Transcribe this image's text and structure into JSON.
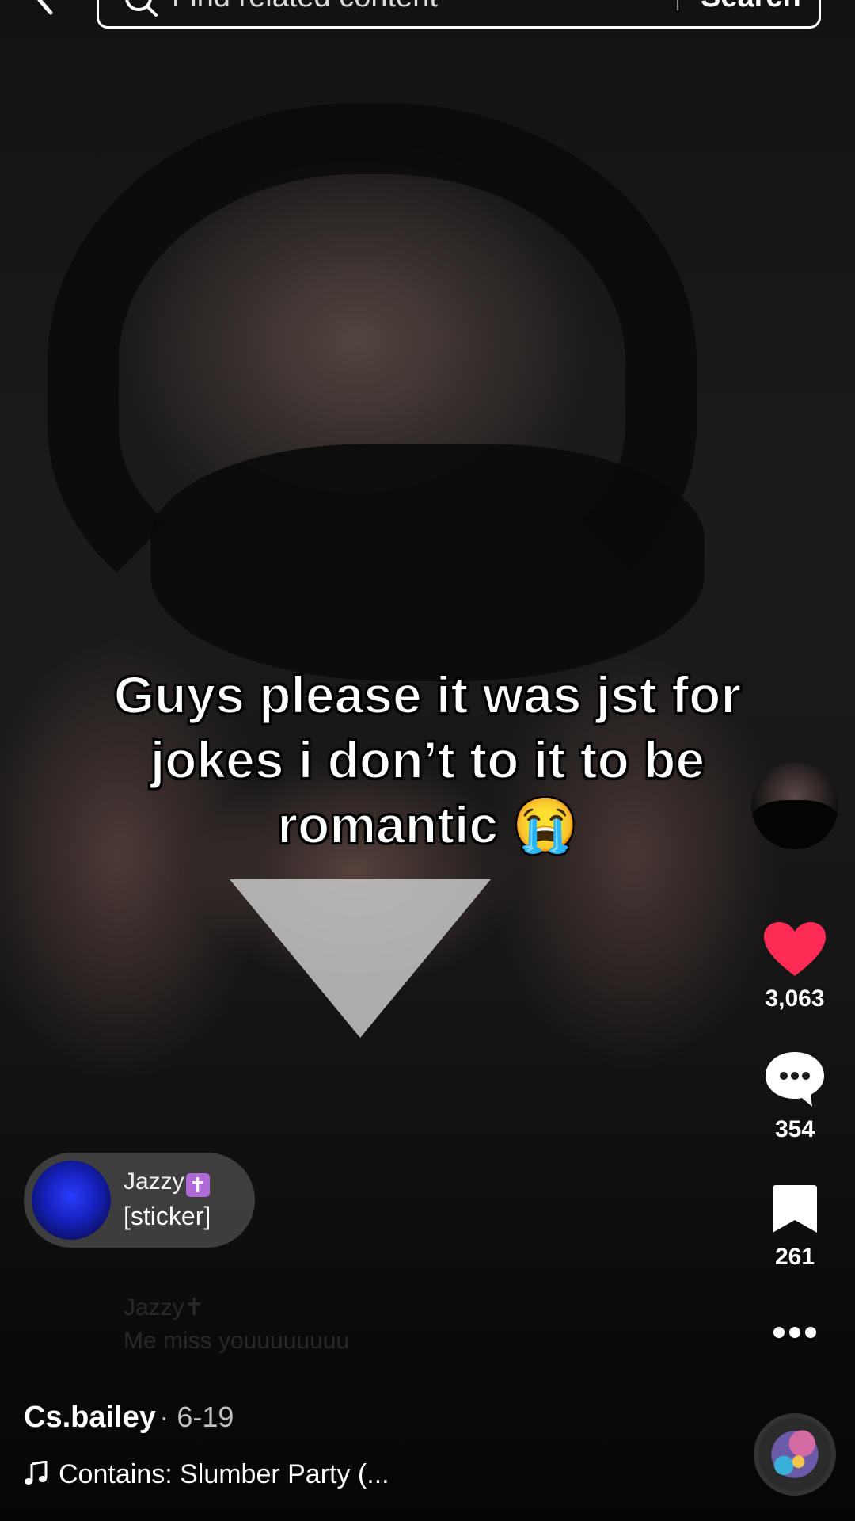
{
  "search": {
    "placeholder": "Find related content",
    "button_label": "Search"
  },
  "caption": {
    "line1": "Guys please it was jst for",
    "line2": "jokes i don’t to it to be",
    "line3": "romantic 😭"
  },
  "actions": {
    "likes": "3,063",
    "comments": "354",
    "saves": "261",
    "like_color": "#fe2c55"
  },
  "comment_bubble": {
    "username": "Jazzy",
    "badge": "✝",
    "text": "[sticker]"
  },
  "faded_comment": {
    "username": "Jazzy✝",
    "text": "Me miss youuuuuuuu"
  },
  "post": {
    "author": "Cs.bailey",
    "date": "· 6-19",
    "sound": "Contains: Slumber Party (..."
  },
  "icons": [
    "back-arrow-icon",
    "search-icon",
    "heart-icon",
    "comment-icon",
    "bookmark-icon",
    "more-icon",
    "music-note-icon"
  ]
}
